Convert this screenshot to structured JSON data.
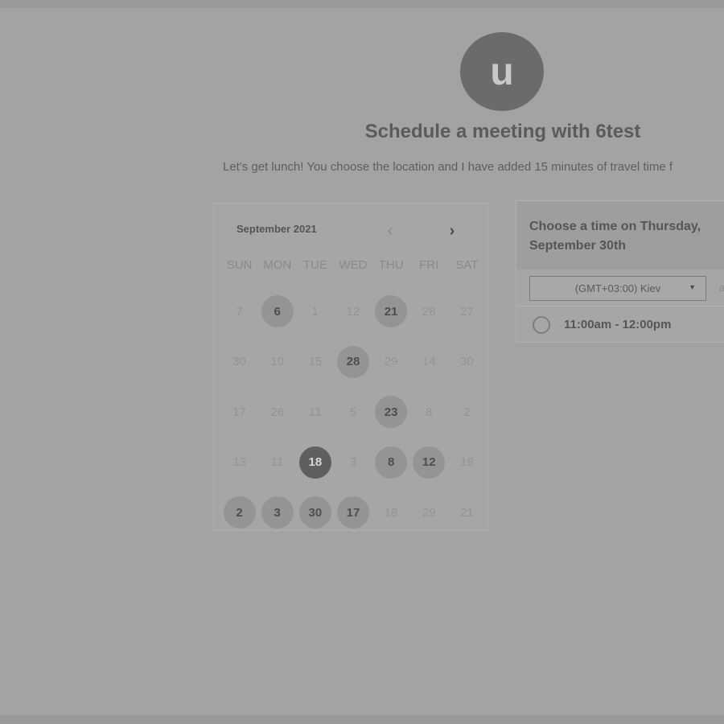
{
  "profile": {
    "avatar_initial": "u"
  },
  "header": {
    "title": "Schedule a meeting with 6test",
    "subtitle": "Let's get lunch! You choose the location and I have added 15 minutes of travel time f"
  },
  "calendar": {
    "month_label": "September 2021",
    "prev_icon": "chevron-left-icon",
    "next_icon": "chevron-right-icon",
    "weekdays": [
      "SUN",
      "MON",
      "TUE",
      "WED",
      "THU",
      "FRI",
      "SAT"
    ],
    "weeks": [
      [
        {
          "d": "7",
          "s": "muted"
        },
        {
          "d": "6",
          "s": "available"
        },
        {
          "d": "1",
          "s": "muted"
        },
        {
          "d": "12",
          "s": "muted"
        },
        {
          "d": "21",
          "s": "available"
        },
        {
          "d": "28",
          "s": "muted"
        },
        {
          "d": "27",
          "s": "muted"
        }
      ],
      [
        {
          "d": "30",
          "s": "muted"
        },
        {
          "d": "10",
          "s": "muted"
        },
        {
          "d": "15",
          "s": "muted"
        },
        {
          "d": "28",
          "s": "available"
        },
        {
          "d": "29",
          "s": "muted"
        },
        {
          "d": "14",
          "s": "muted"
        },
        {
          "d": "30",
          "s": "muted"
        }
      ],
      [
        {
          "d": "17",
          "s": "muted"
        },
        {
          "d": "26",
          "s": "muted"
        },
        {
          "d": "11",
          "s": "muted"
        },
        {
          "d": "5",
          "s": "muted"
        },
        {
          "d": "23",
          "s": "available"
        },
        {
          "d": "8",
          "s": "muted"
        },
        {
          "d": "2",
          "s": "muted"
        }
      ],
      [
        {
          "d": "13",
          "s": "muted"
        },
        {
          "d": "11",
          "s": "muted"
        },
        {
          "d": "18",
          "s": "selected"
        },
        {
          "d": "3",
          "s": "muted"
        },
        {
          "d": "8",
          "s": "available"
        },
        {
          "d": "12",
          "s": "available"
        },
        {
          "d": "18",
          "s": "muted"
        }
      ],
      [
        {
          "d": "2",
          "s": "available"
        },
        {
          "d": "3",
          "s": "available"
        },
        {
          "d": "30",
          "s": "available"
        },
        {
          "d": "17",
          "s": "available"
        },
        {
          "d": "18",
          "s": "muted"
        },
        {
          "d": "29",
          "s": "muted"
        },
        {
          "d": "21",
          "s": "muted"
        }
      ]
    ]
  },
  "time_panel": {
    "heading": "Choose a time on Thursday, September 30th",
    "timezone": "(GMT+03:00) Kiev",
    "timezone_icon": "caret-down-icon",
    "extra": "a",
    "slots": [
      {
        "label": "11:00am - 12:00pm"
      }
    ]
  },
  "colors": {
    "background": "#a3a3a3",
    "available_day": "#949494",
    "selected_day": "#5f5f5f"
  }
}
